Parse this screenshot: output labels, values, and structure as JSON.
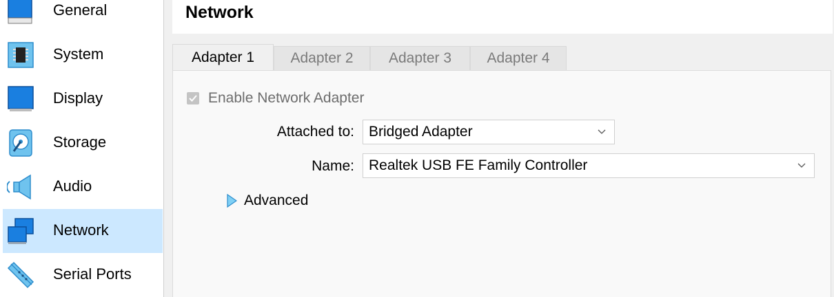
{
  "sidebar": {
    "items": [
      {
        "label": "General",
        "icon": "general-icon"
      },
      {
        "label": "System",
        "icon": "chip-icon"
      },
      {
        "label": "Display",
        "icon": "monitor-icon"
      },
      {
        "label": "Storage",
        "icon": "disk-icon"
      },
      {
        "label": "Audio",
        "icon": "speaker-icon"
      },
      {
        "label": "Network",
        "icon": "network-icon",
        "selected": true
      },
      {
        "label": "Serial Ports",
        "icon": "serial-port-icon"
      }
    ]
  },
  "header": {
    "title": "Network"
  },
  "tabs": [
    {
      "label": "Adapter 1",
      "active": true
    },
    {
      "label": "Adapter 2"
    },
    {
      "label": "Adapter 3"
    },
    {
      "label": "Adapter 4"
    }
  ],
  "adapter": {
    "enable_label": "Enable Network Adapter",
    "enabled": true,
    "attached_label": "Attached to:",
    "attached_value": "Bridged Adapter",
    "name_label": "Name:",
    "name_value": "Realtek USB FE Family Controller",
    "advanced_label": "Advanced"
  },
  "colors": {
    "selection": "#cce8ff",
    "accent": "#1e7fd8"
  }
}
